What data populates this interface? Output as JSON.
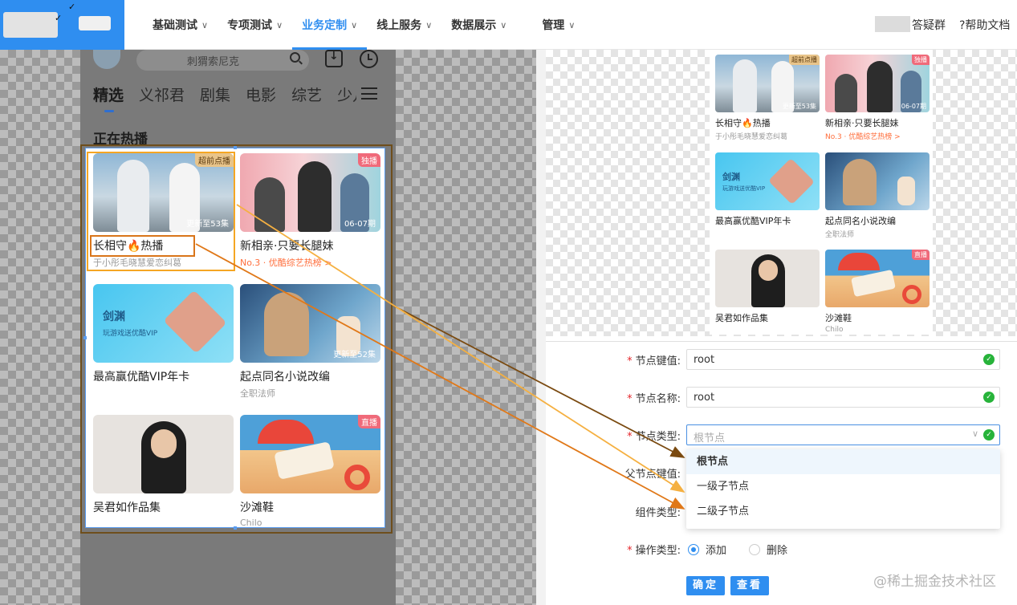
{
  "nav": {
    "items": [
      {
        "label": "基础测试",
        "caret": "∨"
      },
      {
        "label": "专项测试",
        "caret": "∨"
      },
      {
        "label": "业务定制",
        "caret": "∨"
      },
      {
        "label": "线上服务",
        "caret": "∨"
      },
      {
        "label": "数据展示",
        "caret": "∨"
      },
      {
        "label": "管理",
        "caret": "∨"
      }
    ],
    "active_index": 2,
    "group_label": "答疑群",
    "doc_link": "?帮助文档"
  },
  "app": {
    "search_placeholder": "刺猬索尼克",
    "tabs": [
      "精选",
      "义祁君",
      "剧集",
      "电影",
      "综艺",
      "少儿"
    ],
    "section_title": "正在热播",
    "ticks": [
      "✓",
      "✓"
    ]
  },
  "cards": [
    {
      "name": "长相守🔥热播",
      "sub": "于小彤毛晓慧爱恋纠葛",
      "badge": "超前点播",
      "ep": "更新至53集",
      "sub_orange": false
    },
    {
      "name": "新相亲·只要长腿妹",
      "sub": "No.3 · 优酷综艺热榜 >",
      "badge": "独播",
      "ep": "06-07期",
      "sub_orange": true
    },
    {
      "name": "最高赢优酷VIP年卡",
      "sub": "",
      "badge": "",
      "ep": "",
      "sub_orange": false,
      "art_title": "剑渊",
      "art_sub": "玩游戏送优酷VIP"
    },
    {
      "name": "起点同名小说改编",
      "sub": "全职法师",
      "badge": "",
      "ep": "更新至52集",
      "sub_orange": false
    },
    {
      "name": "吴君如作品集",
      "sub": "",
      "badge": "",
      "ep": "",
      "sub_orange": false
    },
    {
      "name": "沙滩鞋",
      "sub": "Chilo",
      "badge": "直播",
      "ep": "",
      "sub_orange": false
    }
  ],
  "preview_cards": [
    {
      "name": "长相守🔥热播",
      "sub": "于小彤毛晓慧爱恋纠葛",
      "badge": "超前点播",
      "ep": "更新至53集",
      "sub_orange": false
    },
    {
      "name": "新相亲·只要长腿妹",
      "sub": "No.3 · 优酷综艺热榜 >",
      "badge": "独播",
      "ep": "06-07期",
      "sub_orange": true
    },
    {
      "name": "最高赢优酷VIP年卡",
      "sub": "",
      "badge": "",
      "ep": "",
      "sub_orange": false,
      "art_title": "剑渊",
      "art_sub": "玩游戏送优酷VIP"
    },
    {
      "name": "起点同名小说改编",
      "sub": "全职法师",
      "badge": "",
      "ep": "",
      "sub_orange": false
    },
    {
      "name": "吴君如作品集",
      "sub": "",
      "badge": "",
      "ep": "",
      "sub_orange": false
    },
    {
      "name": "沙滩鞋",
      "sub": "Chilo",
      "badge": "直播",
      "ep": "",
      "sub_orange": false
    }
  ],
  "form": {
    "node_key_label": "节点键值:",
    "node_key_value": "root",
    "node_name_label": "节点名称:",
    "node_name_value": "root",
    "node_type_label": "节点类型:",
    "node_type_placeholder": "根节点",
    "parent_key_label": "父节点键值:",
    "component_type_label": "组件类型:",
    "op_type_label": "操作类型:",
    "op_options": [
      "添加",
      "删除"
    ],
    "op_selected": 0,
    "dropdown_options": [
      "根节点",
      "一级子节点",
      "二级子节点"
    ],
    "confirm_label": "确定",
    "view_label": "查看",
    "required_mark": "*",
    "ok_mark": "✓",
    "select_caret": "∨"
  },
  "watermark": "@稀土掘金技术社区",
  "colors": {
    "brand": "#2f8ef0",
    "arrow_dark": "#7a4a10",
    "arrow_light": "#f5b041",
    "arrow_orange": "#e07818",
    "ok_green": "#27b33a"
  }
}
